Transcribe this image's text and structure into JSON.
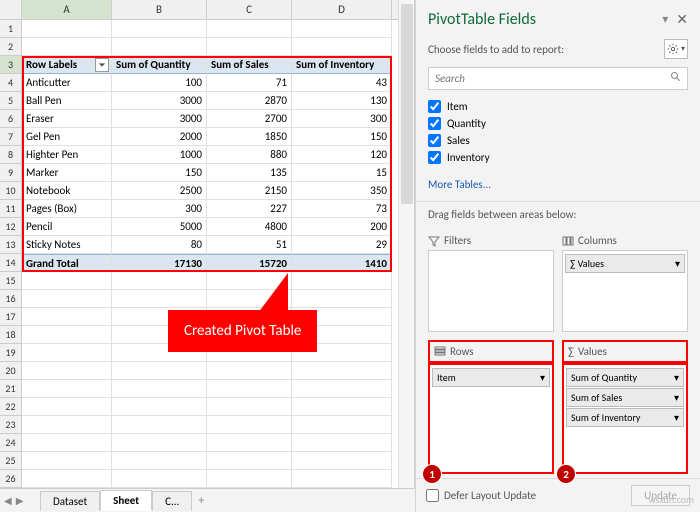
{
  "columns": [
    "A",
    "B",
    "C",
    "D"
  ],
  "header": {
    "row_labels": "Row Labels",
    "b": "Sum of Quantity",
    "c": "Sum of Sales",
    "d": "Sum of Inventory"
  },
  "rows": [
    {
      "label": "Anticutter",
      "q": "100",
      "s": "71",
      "i": "43"
    },
    {
      "label": "Ball Pen",
      "q": "3000",
      "s": "2870",
      "i": "130"
    },
    {
      "label": "Eraser",
      "q": "3000",
      "s": "2700",
      "i": "300"
    },
    {
      "label": "Gel Pen",
      "q": "2000",
      "s": "1850",
      "i": "150"
    },
    {
      "label": "Highter Pen",
      "q": "1000",
      "s": "880",
      "i": "120"
    },
    {
      "label": "Marker",
      "q": "150",
      "s": "135",
      "i": "15"
    },
    {
      "label": "Notebook",
      "q": "2500",
      "s": "2150",
      "i": "350"
    },
    {
      "label": "Pages (Box)",
      "q": "300",
      "s": "227",
      "i": "73"
    },
    {
      "label": "Pencil",
      "q": "5000",
      "s": "4800",
      "i": "200"
    },
    {
      "label": "Sticky Notes",
      "q": "80",
      "s": "51",
      "i": "29"
    }
  ],
  "total": {
    "label": "Grand Total",
    "q": "17130",
    "s": "15720",
    "i": "1410"
  },
  "callout": "Created Pivot Table",
  "tabs": {
    "t1": "Dataset",
    "t2": "Sheet",
    "t3": "C...",
    "add": "+"
  },
  "pane": {
    "title": "PivotTable Fields",
    "sub": "Choose fields to add to report:",
    "search_ph": "Search",
    "fields": {
      "f1": "Item",
      "f2": "Quantity",
      "f3": "Sales",
      "f4": "Inventory"
    },
    "more": "More Tables...",
    "drag": "Drag fields between areas below:",
    "areas": {
      "filters": "Filters",
      "columns": "Columns",
      "rows": "Rows",
      "values": "Values"
    },
    "col_pill": "Values",
    "row_pill": "Item",
    "val_pills": {
      "p1": "Sum of Quantity",
      "p2": "Sum of Sales",
      "p3": "Sum of Inventory"
    },
    "defer": "Defer Layout Update",
    "update": "Update"
  },
  "badges": {
    "b1": "1",
    "b2": "2"
  },
  "watermark": "wsxdn.com"
}
